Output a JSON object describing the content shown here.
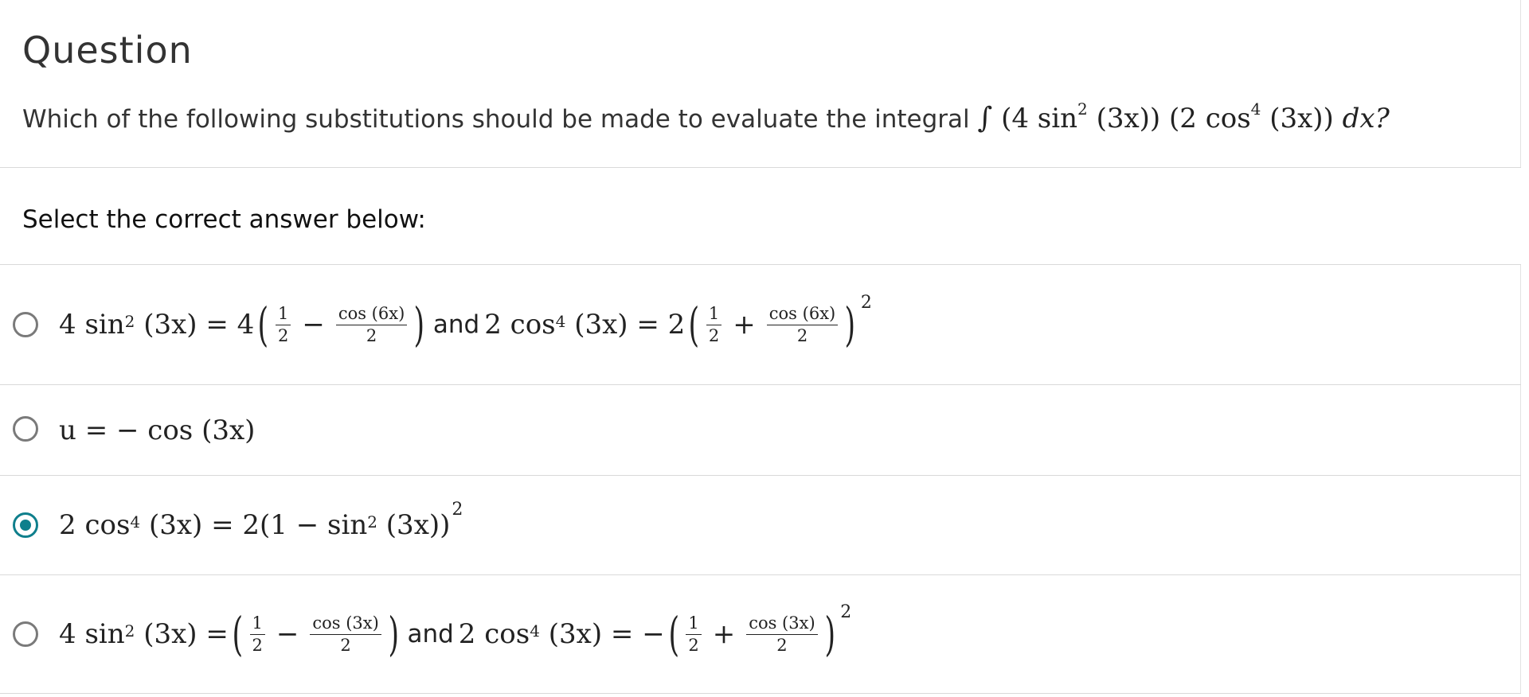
{
  "question": {
    "title": "Question",
    "prompt": "Which of the following substitutions should be made to evaluate the integral",
    "integral": {
      "symbol": "∫",
      "factor1": "(4 sin",
      "factor1_exp": "2",
      "factor1_arg": "(3x))",
      "factor2": "(2 cos",
      "factor2_exp": "4",
      "factor2_arg": "(3x))",
      "dx": "dx?"
    }
  },
  "instruction": "Select the correct answer below:",
  "options": [
    {
      "selected": false,
      "parts": {
        "lhs1": "4 sin",
        "lhs1_exp": "2",
        "lhs1_arg": "(3x) = 4",
        "frac_a_num": "1",
        "frac_a_den": "2",
        "op1": "−",
        "frac_b_num": "cos (6x)",
        "frac_b_den": "2",
        "and": "and",
        "lhs2": "2 cos",
        "lhs2_exp": "4",
        "lhs2_arg": "(3x) = 2",
        "frac_c_num": "1",
        "frac_c_den": "2",
        "op2": "+",
        "frac_d_num": "cos (6x)",
        "frac_d_den": "2",
        "outer_exp": "2"
      }
    },
    {
      "selected": false,
      "text": "u = − cos (3x)"
    },
    {
      "selected": true,
      "parts": {
        "lhs": "2 cos",
        "lhs_exp": "4",
        "mid": "(3x) = 2(1 − sin",
        "mid_exp": "2",
        "tail": "(3x))",
        "outer_exp": "2"
      }
    },
    {
      "selected": false,
      "parts": {
        "lhs1": "4 sin",
        "lhs1_exp": "2",
        "lhs1_arg": "(3x) =",
        "frac_a_num": "1",
        "frac_a_den": "2",
        "op1": "−",
        "frac_b_num": "cos (3x)",
        "frac_b_den": "2",
        "and": "and",
        "lhs2": "2 cos",
        "lhs2_exp": "4",
        "lhs2_arg": "(3x) = −",
        "frac_c_num": "1",
        "frac_c_den": "2",
        "op2": "+",
        "frac_d_num": "cos (3x)",
        "frac_d_den": "2",
        "outer_exp": "2"
      }
    }
  ],
  "colors": {
    "accent": "#0f7f8c",
    "radio_border": "#7a7a7a",
    "divider": "#d9d9d9"
  }
}
